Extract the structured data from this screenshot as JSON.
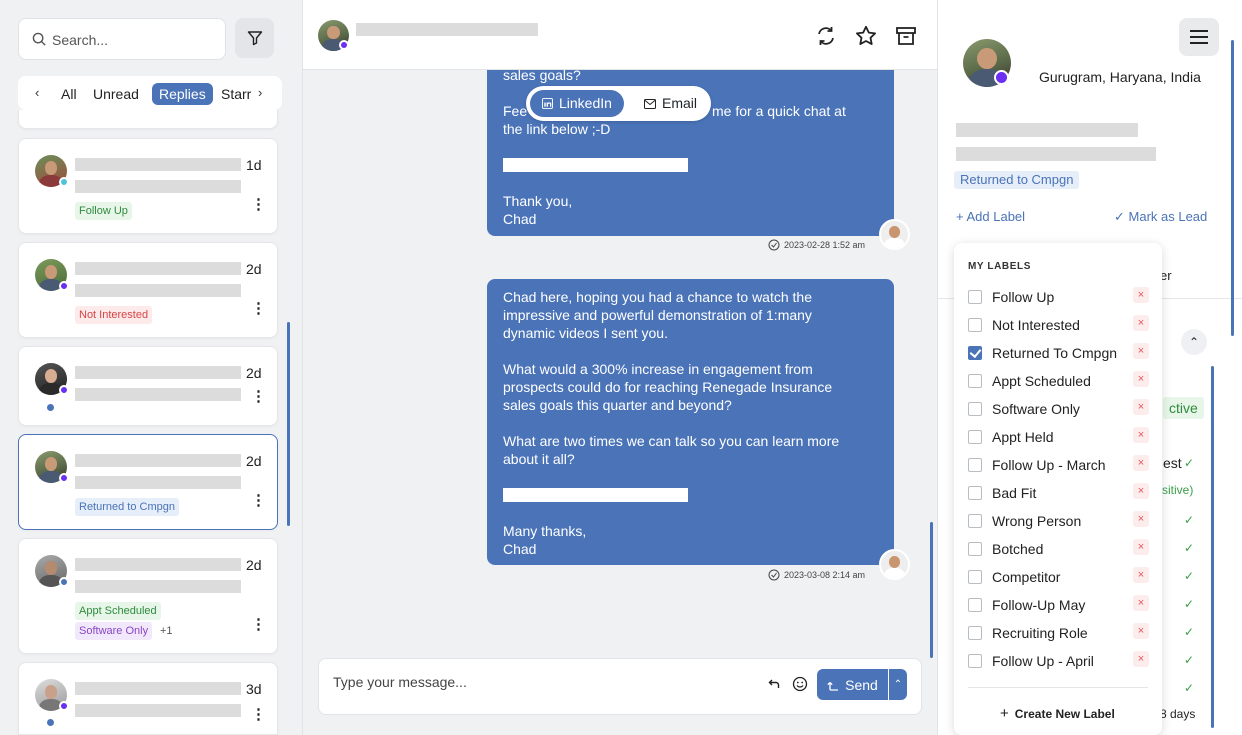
{
  "search": {
    "placeholder": "Search..."
  },
  "tabs": [
    "All",
    "Unread",
    "Replies",
    "Starr"
  ],
  "conversations": [
    {
      "age": "1d",
      "tags": [
        "Follow Up"
      ]
    },
    {
      "age": "2d",
      "tags": [
        "Not Interested"
      ]
    },
    {
      "age": "2d",
      "tags": []
    },
    {
      "age": "2d",
      "tags": [
        "Returned to Cmpgn"
      ]
    },
    {
      "age": "2d",
      "tags": [
        "Appt Scheduled",
        "Software Only"
      ],
      "more": "+1"
    },
    {
      "age": "3d",
      "tags": []
    }
  ],
  "chat": {
    "channels": {
      "linkedin": "LinkedIn",
      "email": "Email"
    },
    "msg1": {
      "line_top": "sales goals?",
      "line_a": "Fee",
      "line_b": "me for a quick chat at",
      "line_c": "the link below ;-D",
      "thanks": "Thank you,",
      "sig": "Chad",
      "stamp": "2023-02-28 1:52 am"
    },
    "msg2": {
      "p1": "Chad here, hoping you had a chance to watch the impressive and powerful demonstration of 1:many dynamic videos I sent you.",
      "p2": "What would a 300% increase in engagement from prospects could do for reaching Renegade Insurance sales goals this quarter and beyond?",
      "p3": "What are two times we can talk so you can learn more about it all?",
      "thanks": "Many thanks,",
      "sig": "Chad",
      "stamp": "2023-03-08 2:14 am"
    },
    "composer_placeholder": "Type your message...",
    "send": "Send"
  },
  "profile": {
    "location": "Gurugram, Haryana, India",
    "current_label": "Returned to Cmpgn",
    "add_label": "+ Add Label",
    "mark_lead": "✓ Mark as Lead"
  },
  "labels_menu": {
    "header": "MY LABELS",
    "items": [
      {
        "name": "Follow Up",
        "checked": false
      },
      {
        "name": "Not Interested",
        "checked": false
      },
      {
        "name": "Returned To Cmpgn",
        "checked": true
      },
      {
        "name": "Appt Scheduled",
        "checked": false
      },
      {
        "name": "Software Only",
        "checked": false
      },
      {
        "name": "Appt Held",
        "checked": false
      },
      {
        "name": "Follow Up - March",
        "checked": false
      },
      {
        "name": "Bad Fit",
        "checked": false
      },
      {
        "name": "Wrong Person",
        "checked": false
      },
      {
        "name": "Botched",
        "checked": false
      },
      {
        "name": "Competitor",
        "checked": false
      },
      {
        "name": "Follow-Up May",
        "checked": false
      },
      {
        "name": "Recruiting Role",
        "checked": false
      },
      {
        "name": "Follow Up - April",
        "checked": false
      }
    ],
    "create": "Create New Label"
  },
  "background_fragments": {
    "er": "er",
    "ctive": "ctive",
    "est": "est",
    "sitive": "sitive)",
    "days": "8 days"
  },
  "colors": {
    "accent": "#4a73b8",
    "presence": "#6a2ff0"
  }
}
